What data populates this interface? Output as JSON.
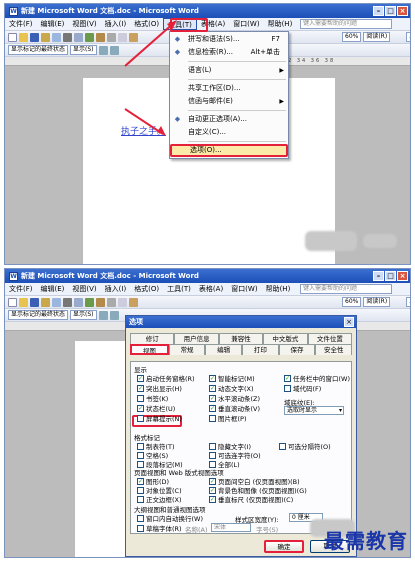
{
  "top": {
    "title": "新建 Microsoft Word 文档.doc - Microsoft Word",
    "menus": [
      "文件(F)",
      "编辑(E)",
      "视图(V)",
      "插入(I)",
      "格式(O)",
      "工具(T)",
      "表格(A)",
      "窗口(W)",
      "帮助(H)"
    ],
    "help_placeholder": "键入需要帮助的问题",
    "zoom": "60%",
    "read_mode": "阅读(R)",
    "font_size": "二号",
    "show_markup": "显示标记的最终状态",
    "show": "显示(S)",
    "ruler_marks": "28 30 32 34 36 38",
    "doc_text": "执子之手。",
    "tools_menu": [
      {
        "label": "拼写和语法(S)...",
        "shortcut": "F7",
        "icon": "spellcheck-icon"
      },
      {
        "label": "信息检索(R)...",
        "shortcut": "Alt+单击",
        "icon": "research-icon"
      },
      {
        "label": "语言(L)",
        "submenu": true
      },
      {
        "label": "共享工作区(D)..."
      },
      {
        "label": "信函与邮件(E)",
        "submenu": true
      },
      {
        "label": "自动更正选项(A)...",
        "icon": "autocorrect-icon"
      },
      {
        "label": "自定义(C)..."
      },
      {
        "label": "选项(O)...",
        "highlight": true
      }
    ]
  },
  "bottom": {
    "title": "新建 Microsoft Word 文档.doc - Microsoft Word",
    "menus": [
      "文件(F)",
      "编辑(E)",
      "视图(V)",
      "插入(I)",
      "格式(O)",
      "工具(T)",
      "表格(A)",
      "窗口(W)",
      "帮助(H)"
    ],
    "help_placeholder": "键入需要帮助的问题",
    "zoom": "60%",
    "read_mode": "阅读(R)",
    "font_size": "二号",
    "show_markup": "显示标记的最终状态",
    "show": "显示(S)",
    "dialog": {
      "title": "选项",
      "tabs_row1": [
        "修订",
        "用户信息",
        "兼容性",
        "中文版式",
        "文件位置"
      ],
      "tabs_row2": [
        "视图",
        "常规",
        "编辑",
        "打印",
        "保存",
        "安全性"
      ],
      "section_show": "显示",
      "show_items_col1": [
        {
          "label": "启动任务窗格(R)",
          "checked": true
        },
        {
          "label": "突出显示(H)",
          "checked": true
        },
        {
          "label": "书签(K)",
          "checked": false
        },
        {
          "label": "状态栏(U)",
          "checked": true
        },
        {
          "label": "屏幕提示(N)",
          "checked": false,
          "highlight": true
        }
      ],
      "show_items_col2": [
        {
          "label": "智能标记(M)",
          "checked": true
        },
        {
          "label": "动态文字(X)",
          "checked": true
        },
        {
          "label": "水平滚动条(Z)",
          "checked": true
        },
        {
          "label": "垂直滚动条(V)",
          "checked": true
        },
        {
          "label": "图片框(P)",
          "checked": false
        }
      ],
      "show_items_col3": [
        {
          "label": "任务栏中的窗口(W)",
          "checked": true
        },
        {
          "label": "域代码(F)",
          "checked": false
        }
      ],
      "shading_label": "域底纹(E):",
      "shading_value": "选取时显示",
      "section_format": "格式标记",
      "format_items_col1": [
        "制表符(T)",
        "空格(S)",
        "段落标记(M)"
      ],
      "format_items_col2": [
        "隐藏文字(I)",
        "可选连字符(O)",
        "全部(L)"
      ],
      "format_item_col3": "可选分隔符(O)",
      "section_layout": "页面视图和 Web 版式视图选项",
      "layout_col1": [
        {
          "label": "图形(D)",
          "checked": true
        },
        {
          "label": "对象位置(C)",
          "checked": false
        },
        {
          "label": "正文边框(X)",
          "checked": false
        }
      ],
      "layout_col2": [
        {
          "label": "页面间空白 (仅页面视图)(B)",
          "checked": true
        },
        {
          "label": "背景色和图像 (仅页面视图)(G)",
          "checked": true
        },
        {
          "label": "垂直标尺 (仅页面视图)(C)",
          "checked": true
        }
      ],
      "section_outline": "大纲视图和普通视图选项",
      "outline_items": [
        "窗口内自动换行(W)",
        "草稿字体(R)"
      ],
      "name_label": "名称(A)",
      "name_value": "宋体",
      "size_label": "字号(S)",
      "style_width_label": "样式区宽度(Y):",
      "style_width_value": "0 厘米",
      "ok": "确定",
      "cancel": "取消"
    },
    "watermark": "最需教育"
  }
}
